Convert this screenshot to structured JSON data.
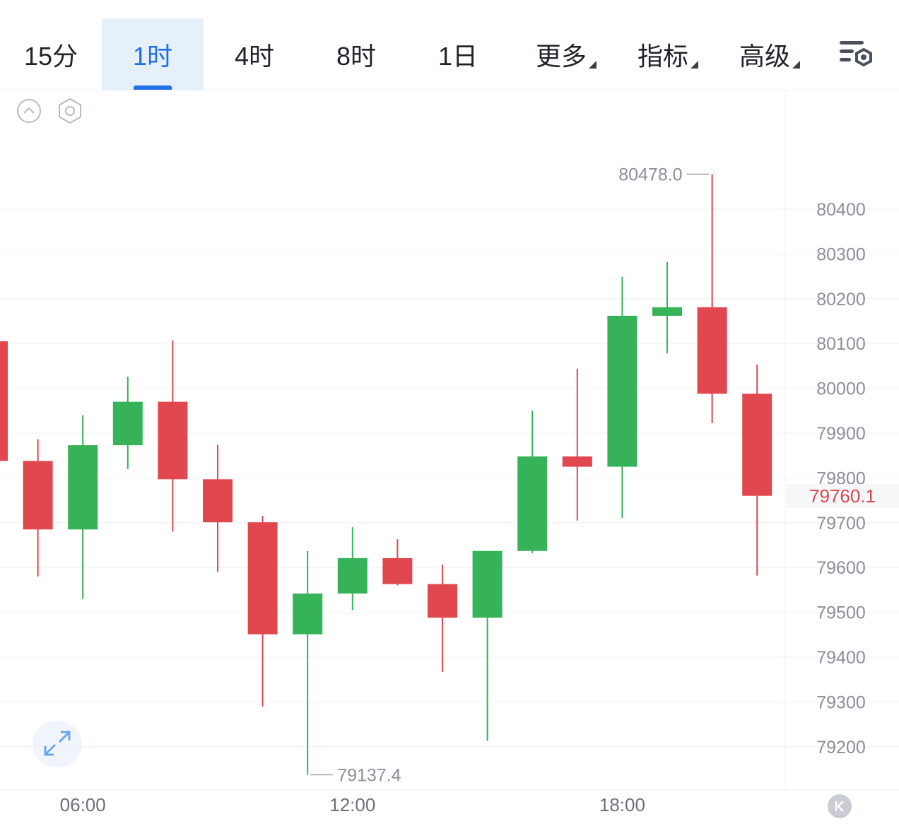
{
  "tabs": [
    {
      "label": "15分",
      "active": false,
      "dropdown": false
    },
    {
      "label": "1时",
      "active": true,
      "dropdown": false
    },
    {
      "label": "4时",
      "active": false,
      "dropdown": false
    },
    {
      "label": "8时",
      "active": false,
      "dropdown": false
    },
    {
      "label": "1日",
      "active": false,
      "dropdown": false
    },
    {
      "label": "更多",
      "active": false,
      "dropdown": true
    },
    {
      "label": "指标",
      "active": false,
      "dropdown": true
    },
    {
      "label": "高级",
      "active": false,
      "dropdown": true
    }
  ],
  "icons": {
    "settings": "chart-settings-icon",
    "collapse": "chevron-up-circle-icon",
    "indicator_settings": "hexagon-gear-icon",
    "expand": "expand-arrows-icon",
    "reset": "scroll-to-latest-icon"
  },
  "colors": {
    "up": "#36b358",
    "down": "#e0474e",
    "accent": "#1f6fe6",
    "axis_text": "#8a8f99"
  },
  "chart_data": {
    "type": "candlestick",
    "interval": "1时",
    "x_ticks": [
      "06:00",
      "12:00",
      "18:00"
    ],
    "y_ticks": [
      79200,
      79300,
      79400,
      79500,
      79600,
      79700,
      79800,
      79900,
      80000,
      80100,
      80200,
      80300,
      80400
    ],
    "ylim": [
      79120,
      80560
    ],
    "grid": true,
    "high_label": "80478.0",
    "low_label": "79137.4",
    "latest_price_label": "79760.1",
    "candles": [
      {
        "open": 80105,
        "high": 80130,
        "low": 79838,
        "close": 79838
      },
      {
        "open": 79838,
        "high": 79886,
        "low": 79580,
        "close": 79685
      },
      {
        "open": 79685,
        "high": 79940,
        "low": 79530,
        "close": 79873
      },
      {
        "open": 79873,
        "high": 80026,
        "low": 79820,
        "close": 79970
      },
      {
        "open": 79970,
        "high": 80107,
        "low": 79680,
        "close": 79797
      },
      {
        "open": 79797,
        "high": 79874,
        "low": 79590,
        "close": 79701
      },
      {
        "open": 79701,
        "high": 79715,
        "low": 79290,
        "close": 79451
      },
      {
        "open": 79451,
        "high": 79637,
        "low": 79137.4,
        "close": 79542
      },
      {
        "open": 79542,
        "high": 79690,
        "low": 79505,
        "close": 79621
      },
      {
        "open": 79621,
        "high": 79663,
        "low": 79560,
        "close": 79563
      },
      {
        "open": 79563,
        "high": 79606,
        "low": 79367,
        "close": 79488
      },
      {
        "open": 79488,
        "high": 79636,
        "low": 79213,
        "close": 79637
      },
      {
        "open": 79637,
        "high": 79950,
        "low": 79632,
        "close": 79848
      },
      {
        "open": 79848,
        "high": 80044,
        "low": 79705,
        "close": 79825
      },
      {
        "open": 79825,
        "high": 80249,
        "low": 79711,
        "close": 80162
      },
      {
        "open": 80162,
        "high": 80282,
        "low": 80078,
        "close": 80181
      },
      {
        "open": 80181,
        "high": 80478.0,
        "low": 79922,
        "close": 79988
      },
      {
        "open": 79988,
        "high": 80053,
        "low": 79582,
        "close": 79760.1
      }
    ]
  }
}
